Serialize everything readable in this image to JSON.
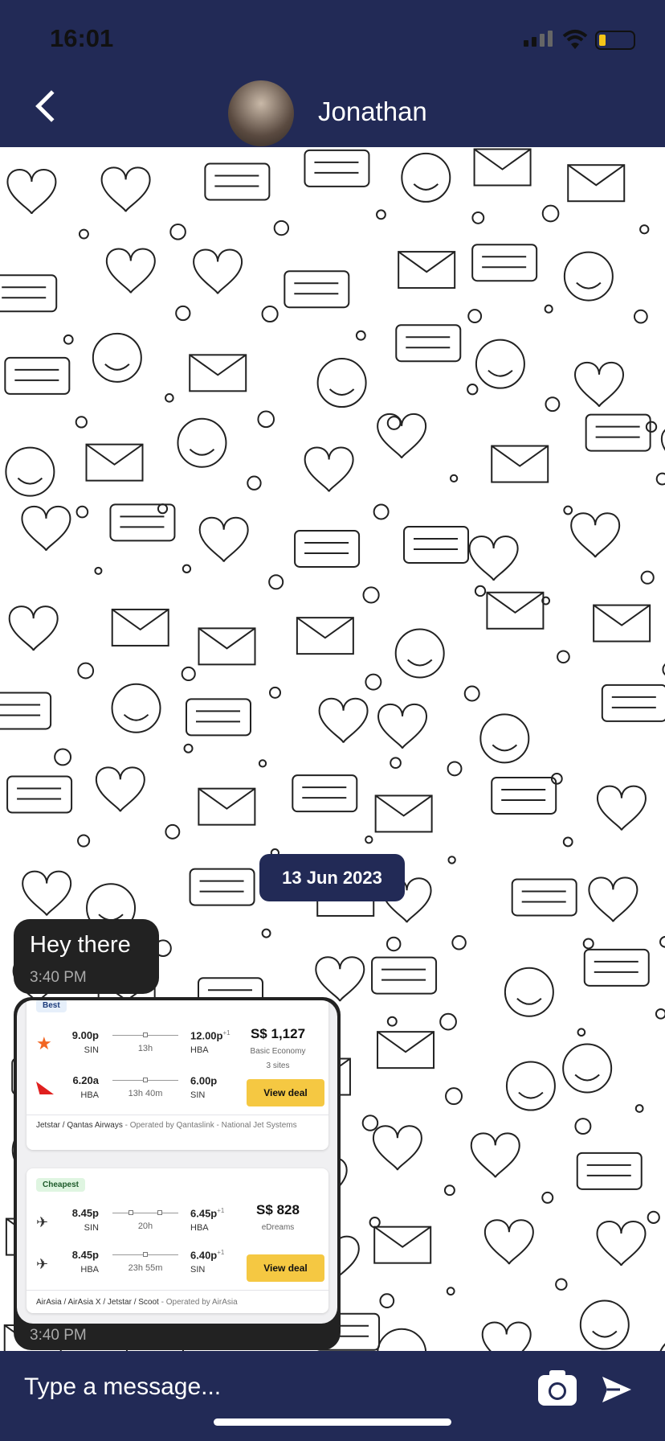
{
  "status": {
    "time": "16:01"
  },
  "header": {
    "contact_name": "Jonathan"
  },
  "chat": {
    "date_label": "13 Jun 2023",
    "messages": [
      {
        "text": "Hey there",
        "time": "3:40 PM"
      },
      {
        "type": "image",
        "time": "3:40 PM",
        "flights": [
          {
            "tag": "Best",
            "tag_color": "#e6effa",
            "tag_text_color": "#1a3a7a",
            "legs": [
              {
                "airline_icon": "jetstar-star-icon",
                "dep_time": "9.00p",
                "dep_code": "SIN",
                "duration": "13h",
                "arr_time": "12.00p",
                "arr_plus": "+1",
                "arr_code": "HBA"
              },
              {
                "airline_icon": "qantas-kangaroo-icon",
                "dep_time": "6.20a",
                "dep_code": "HBA",
                "duration": "13h 40m",
                "arr_time": "6.00p",
                "arr_plus": "",
                "arr_code": "SIN"
              }
            ],
            "price": "S$ 1,127",
            "fare": "Basic Economy",
            "sites": "3 sites",
            "button": "View deal",
            "airlines": "Jetstar / Qantas Airways",
            "operated": " - Operated by Qantaslink - National Jet Systems"
          },
          {
            "tag": "Cheapest",
            "tag_color": "#dff5e1",
            "tag_text_color": "#1d5a2a",
            "legs": [
              {
                "airline_icon": "plane-icon",
                "dep_time": "8.45p",
                "dep_code": "SIN",
                "duration": "20h",
                "arr_time": "6.45p",
                "arr_plus": "+1",
                "arr_code": "HBA"
              },
              {
                "airline_icon": "plane-icon",
                "dep_time": "8.45p",
                "dep_code": "HBA",
                "duration": "23h 55m",
                "arr_time": "6.40p",
                "arr_plus": "+1",
                "arr_code": "SIN"
              }
            ],
            "price": "S$ 828",
            "fare": "eDreams",
            "sites": "",
            "button": "View deal",
            "airlines": "AirAsia / AirAsia X / Jetstar / Scoot",
            "operated": " - Operated by AirAsia"
          }
        ]
      }
    ]
  },
  "composer": {
    "placeholder": "Type a message..."
  },
  "colors": {
    "header": "#222a56",
    "bubble": "#222222",
    "deal_button": "#f5c842"
  }
}
